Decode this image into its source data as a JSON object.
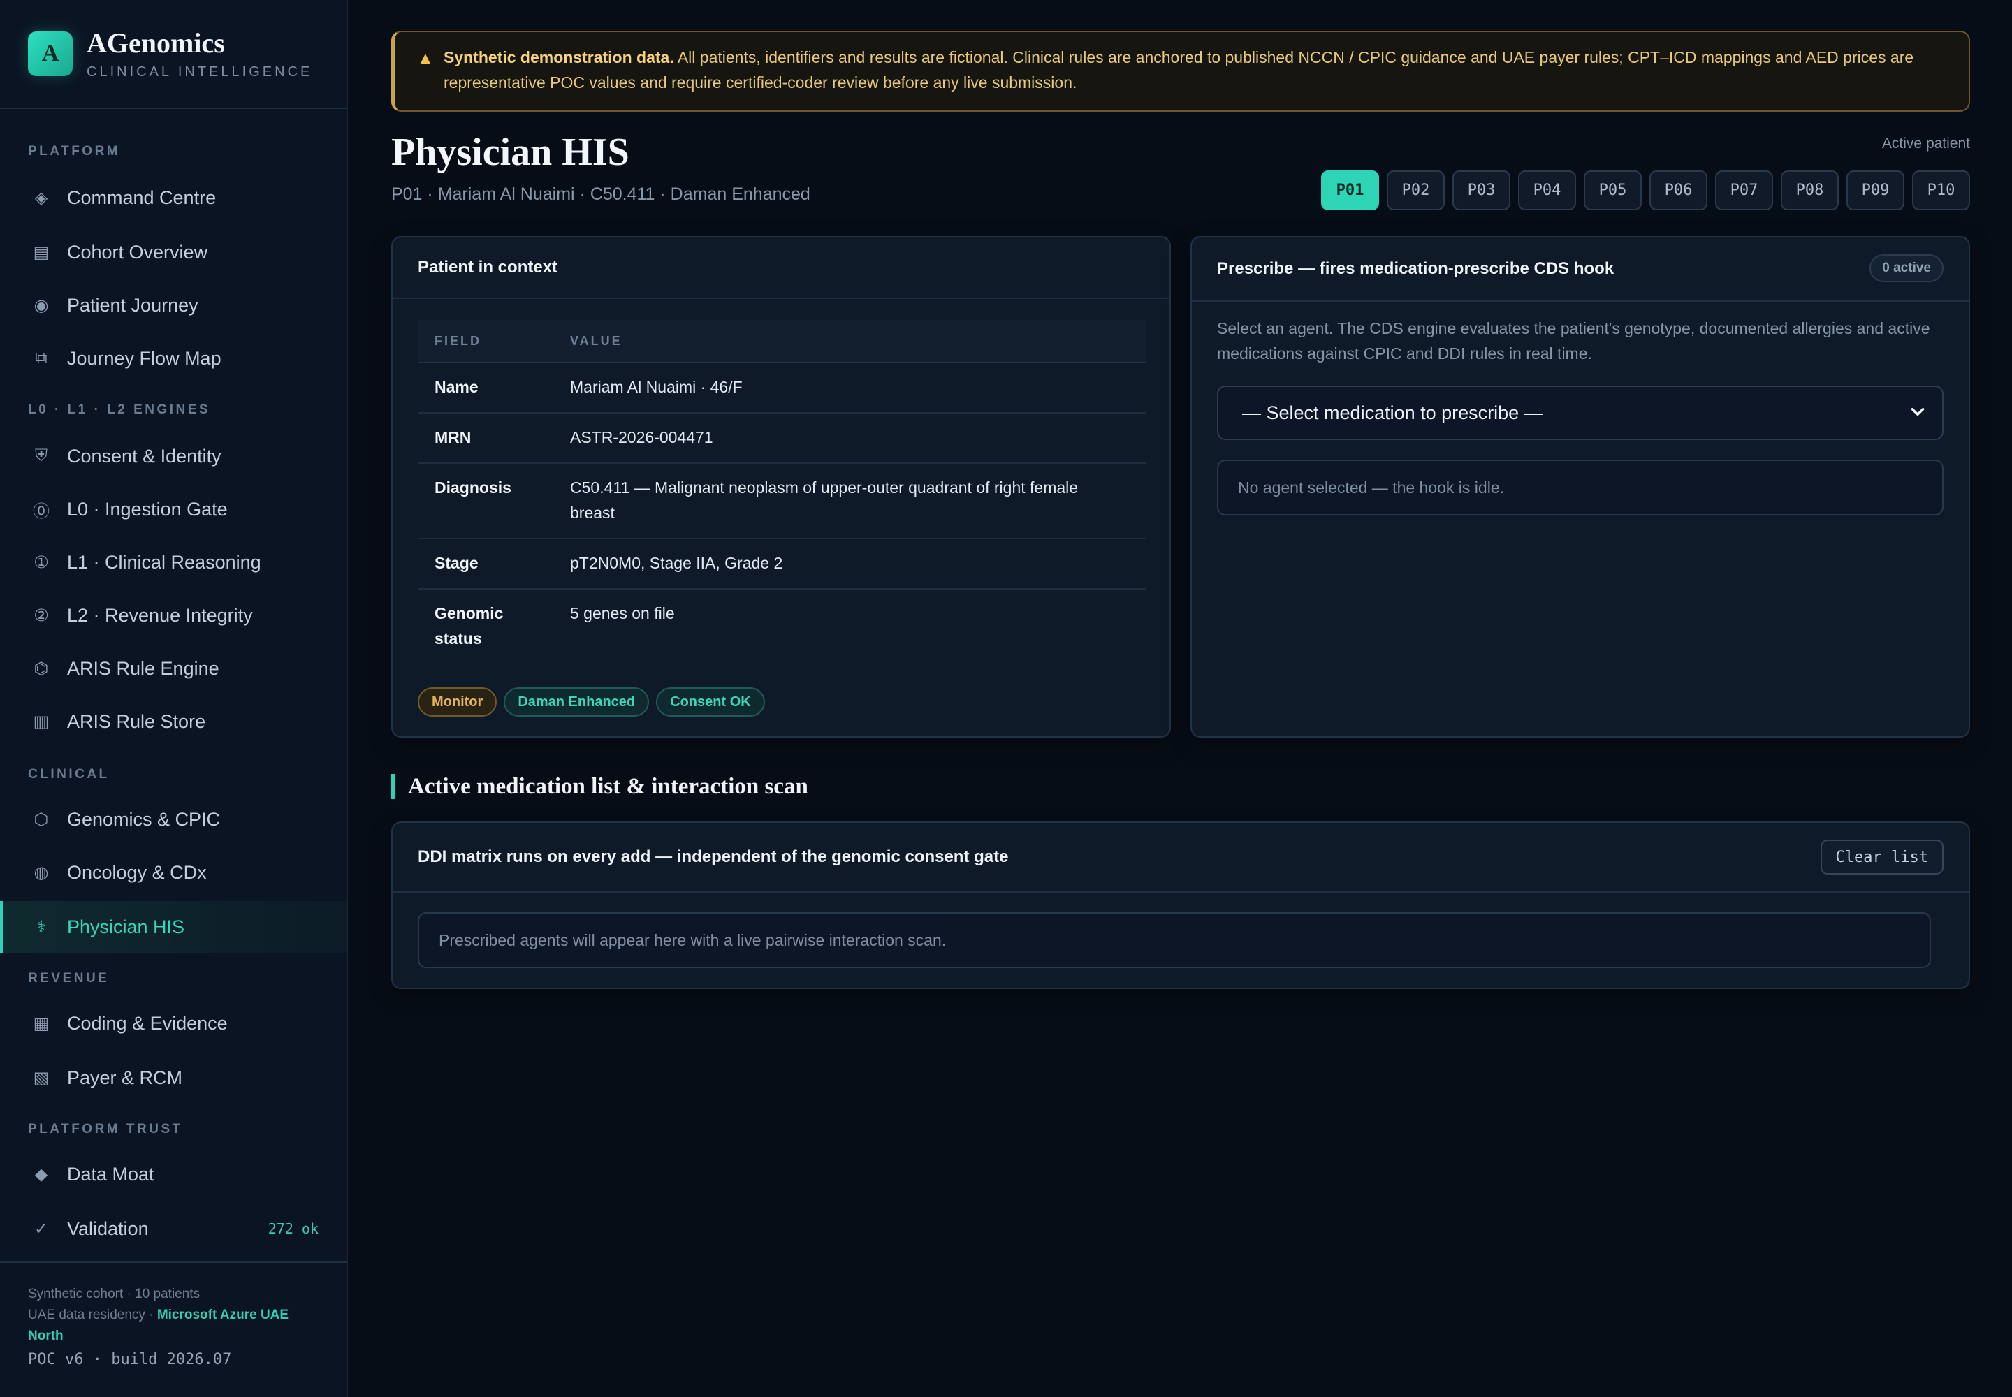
{
  "brand": {
    "logo_letter": "A",
    "name": "AGenomics",
    "subtitle": "CLINICAL INTELLIGENCE"
  },
  "sidebar": {
    "sections": [
      "PLATFORM",
      "L0 · L1 · L2 ENGINES",
      "CLINICAL",
      "REVENUE",
      "PLATFORM TRUST"
    ],
    "items": [
      {
        "label": "Command Centre",
        "icon": "diamond-outline-icon"
      },
      {
        "label": "Cohort Overview",
        "icon": "table-icon"
      },
      {
        "label": "Patient Journey",
        "icon": "target-icon"
      },
      {
        "label": "Journey Flow Map",
        "icon": "layers-icon"
      },
      {
        "label": "Consent & Identity",
        "icon": "shield-icon"
      },
      {
        "label": "L0 · Ingestion Gate",
        "icon": "circled-zero-icon"
      },
      {
        "label": "L1 · Clinical Reasoning",
        "icon": "circled-one-icon"
      },
      {
        "label": "L2 · Revenue Integrity",
        "icon": "circled-two-icon"
      },
      {
        "label": "ARIS Rule Engine",
        "icon": "hexagon-rules-icon"
      },
      {
        "label": "ARIS Rule Store",
        "icon": "grid-store-icon"
      },
      {
        "label": "Genomics & CPIC",
        "icon": "hexagon-icon"
      },
      {
        "label": "Oncology & CDx",
        "icon": "dotted-circle-icon"
      },
      {
        "label": "Physician HIS",
        "icon": "caduceus-icon"
      },
      {
        "label": "Coding & Evidence",
        "icon": "square-grid-icon"
      },
      {
        "label": "Payer & RCM",
        "icon": "hatched-square-icon"
      },
      {
        "label": "Data Moat",
        "icon": "diamond-filled-icon"
      },
      {
        "label": "Validation",
        "icon": "check-icon",
        "badge": "272 ok"
      }
    ],
    "footer": {
      "cohort": "Synthetic cohort · 10 patients",
      "residency_prefix": "UAE data residency · ",
      "residency_region": "Microsoft Azure UAE North",
      "build": "POC v6 · build 2026.07"
    }
  },
  "alert": {
    "icon": "warning-icon",
    "title": "Synthetic demonstration data.",
    "body": "All patients, identifiers and results are fictional. Clinical rules are anchored to published NCCN / CPIC guidance and UAE payer rules; CPT–ICD mappings and AED prices are representative POC values and require certified-coder review before any live submission."
  },
  "header": {
    "title": "Physician HIS",
    "subtitle": "P01 · Mariam Al Nuaimi · C50.411 · Daman Enhanced",
    "active_patient_label": "Active patient",
    "patients": [
      "P01",
      "P02",
      "P03",
      "P04",
      "P05",
      "P06",
      "P07",
      "P08",
      "P09",
      "P10"
    ],
    "selected_patient": "P01"
  },
  "patient_card": {
    "title": "Patient in context",
    "columns": [
      "FIELD",
      "VALUE"
    ],
    "rows": [
      {
        "field": "Name",
        "value": "Mariam Al Nuaimi · 46/F"
      },
      {
        "field": "MRN",
        "value": "ASTR-2026-004471"
      },
      {
        "field": "Diagnosis",
        "value": "C50.411 — Malignant neoplasm of upper-outer quadrant of right female breast"
      },
      {
        "field": "Stage",
        "value": "pT2N0M0, Stage IIA, Grade 2"
      },
      {
        "field": "Genomic status",
        "value": "5 genes on file"
      }
    ],
    "tags": [
      "Monitor",
      "Daman Enhanced",
      "Consent OK"
    ]
  },
  "prescribe_card": {
    "title": "Prescribe — fires medication-prescribe CDS hook",
    "active_count": "0 active",
    "description": "Select an agent. The CDS engine evaluates the patient's genotype, documented allergies and active medications against CPIC and DDI rules in real time.",
    "select_value": "— Select medication to prescribe —",
    "status": "No agent selected — the hook is idle."
  },
  "medication_section": {
    "title": "Active medication list & interaction scan",
    "card_title": "DDI matrix runs on every add — independent of the genomic consent gate",
    "clear_label": "Clear list",
    "empty_text": "Prescribed agents will appear here with a live pairwise interaction scan."
  },
  "colors": {
    "accent": "#2ed3b7",
    "warning": "#c9a24a",
    "background": "#070d17"
  }
}
